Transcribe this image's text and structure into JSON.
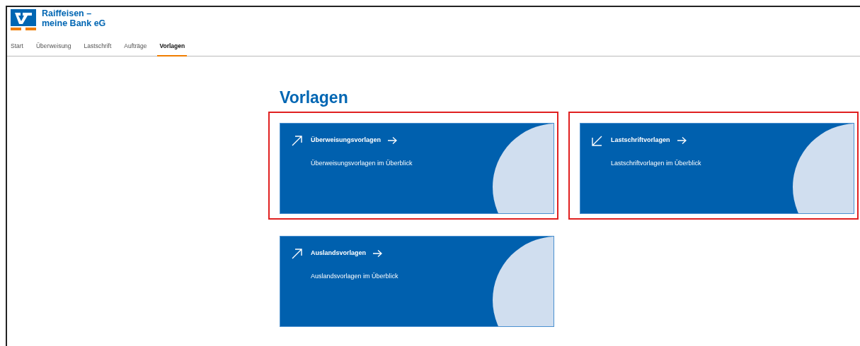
{
  "bank_name": [
    "Raiffeisen –",
    "meine Bank eG"
  ],
  "tabs": [
    {
      "label": "Start",
      "selected": false
    },
    {
      "label": "Überweisung",
      "selected": false
    },
    {
      "label": "Lastschrift",
      "selected": false
    },
    {
      "label": "Aufträge",
      "selected": false
    },
    {
      "label": "Vorlagen",
      "selected": true
    }
  ],
  "page_title": "Vorlagen",
  "cards": [
    {
      "kind": "outgoing",
      "title": "Überweisungsvorlagen",
      "subtitle": "Überweisungsvorlagen im Überblick",
      "highlighted": true
    },
    {
      "kind": "incoming",
      "title": "Lastschriftvorlagen",
      "subtitle": "Lastschriftvorlagen im Überblick",
      "highlighted": true
    },
    {
      "kind": "outgoing",
      "title": "Auslandsvorlagen",
      "subtitle": "Auslandsvorlagen im Überblick",
      "highlighted": false
    }
  ]
}
